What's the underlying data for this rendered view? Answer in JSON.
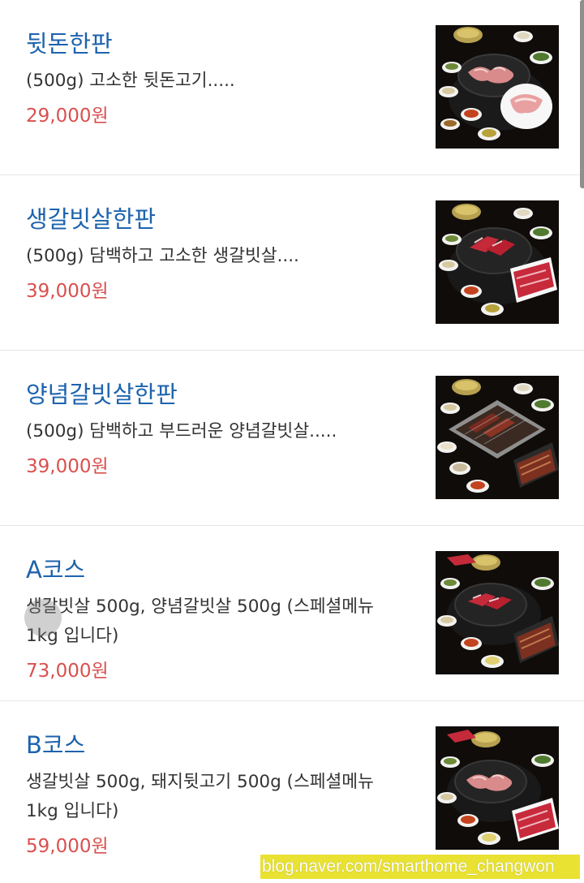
{
  "menu": {
    "items": [
      {
        "name": "뒷돈한판",
        "description": "(500g) 고소한 뒷돈고기.....",
        "price": "29,000원",
        "photo_icon": "grilled-pork-platter-photo"
      },
      {
        "name": "생갈빗살한판",
        "description": "(500g) 담백하고 고소한 생갈빗살....",
        "price": "39,000원",
        "photo_icon": "raw-beef-rib-platter-photo"
      },
      {
        "name": "양념갈빗살한판",
        "description": "(500g) 담백하고 부드러운 양념갈빗살.....",
        "price": "39,000원",
        "photo_icon": "marinated-rib-platter-photo"
      },
      {
        "name": "A코스",
        "description": "생갈빗살 500g, 양념갈빗살 500g (스페셜메뉴 1kg 입니다)",
        "price": "73,000원",
        "photo_icon": "course-a-platter-photo"
      },
      {
        "name": "B코스",
        "description": "생갈빗살 500g, 돼지뒷고기 500g (스페셜메뉴 1kg 입니다)",
        "price": "59,000원",
        "photo_icon": "course-b-platter-photo"
      }
    ]
  },
  "watermark": {
    "text": "blog.naver.com/smarthome_changwon"
  },
  "colors": {
    "name": "#1d63ad",
    "price": "#d9504f",
    "description": "#333333",
    "watermark_bg": "#e9e232"
  }
}
